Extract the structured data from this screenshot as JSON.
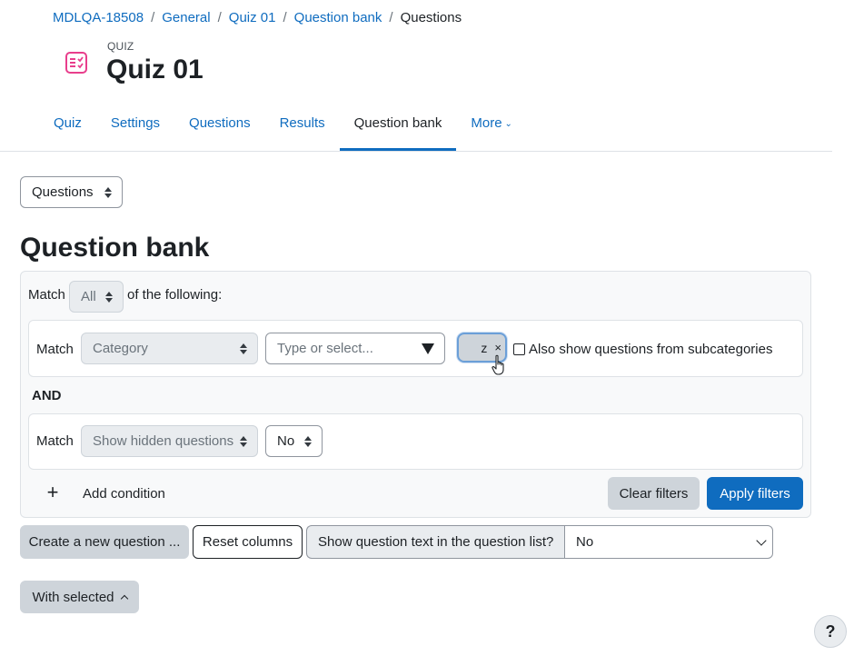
{
  "breadcrumb": [
    {
      "label": "MDLQA-18508"
    },
    {
      "label": "General"
    },
    {
      "label": "Quiz 01"
    },
    {
      "label": "Question bank"
    },
    {
      "label": "Questions"
    }
  ],
  "header": {
    "kicker": "QUIZ",
    "title": "Quiz 01",
    "icon": "quiz-icon",
    "icon_color": "#e83e8c"
  },
  "tabs": [
    {
      "label": "Quiz",
      "active": false
    },
    {
      "label": "Settings",
      "active": false
    },
    {
      "label": "Questions",
      "active": false
    },
    {
      "label": "Results",
      "active": false
    },
    {
      "label": "Question bank",
      "active": true
    },
    {
      "label": "More",
      "active": false
    }
  ],
  "bank_select": {
    "value": "Questions"
  },
  "section_title": "Question bank",
  "filters": {
    "match_label": "Match",
    "match_value": "All",
    "of_following": "of the following:",
    "conditions": [
      {
        "match_label": "Match",
        "field": "Category",
        "type_placeholder": "Type or select...",
        "selected_pill": "z",
        "remove_glyph": "×",
        "checkbox_label": "Also show questions from subcategories",
        "checked": false
      },
      {
        "match_label": "Match",
        "field": "Show hidden questions",
        "value": "No"
      }
    ],
    "join": "AND",
    "add_condition_icon": "+",
    "add_condition": "Add condition",
    "clear": "Clear filters",
    "apply": "Apply filters"
  },
  "toolbar": {
    "create": "Create a new question ...",
    "reset": "Reset columns",
    "show_text_label": "Show question text in the question list?",
    "show_text_value": "No"
  },
  "with_selected": "With selected",
  "help": "?",
  "colors": {
    "primary": "#0f6cbf",
    "text": "#1d2125",
    "muted": "#6a737b"
  }
}
